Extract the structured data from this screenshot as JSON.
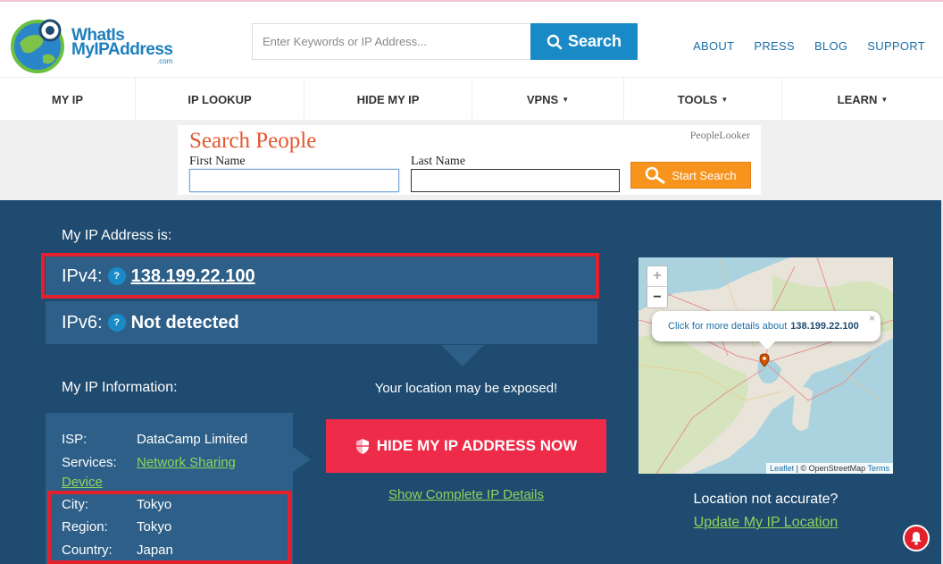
{
  "header": {
    "logo_line1": "WhatIs",
    "logo_line2": "MyIPAddress",
    "logo_suffix": ".com",
    "search_placeholder": "Enter Keywords or IP Address...",
    "search_button": "Search",
    "links": [
      "ABOUT",
      "PRESS",
      "BLOG",
      "SUPPORT"
    ]
  },
  "nav": {
    "items": [
      {
        "label": "MY IP",
        "dropdown": false
      },
      {
        "label": "IP LOOKUP",
        "dropdown": false
      },
      {
        "label": "HIDE MY IP",
        "dropdown": false
      },
      {
        "label": "VPNS",
        "dropdown": true
      },
      {
        "label": "TOOLS",
        "dropdown": true
      },
      {
        "label": "LEARN",
        "dropdown": true
      }
    ],
    "caret": "▼"
  },
  "ad": {
    "title": "Search People",
    "brand": "PeopleLooker",
    "first_name_label": "First Name",
    "last_name_label": "Last Name",
    "first_name_value": "",
    "last_name_value": "",
    "button": "Start Search"
  },
  "main": {
    "ip_heading": "My IP Address is:",
    "ipv4_label": "IPv4:",
    "ipv4_value": "138.199.22.100",
    "ipv6_label": "IPv6:",
    "ipv6_value": "Not detected",
    "help_glyph": "?",
    "info_heading": "My IP Information:",
    "info": {
      "isp_label": "ISP:",
      "isp_value": "DataCamp Limited",
      "services_label": "Services:",
      "services_value_line1": "Network Sharing",
      "services_value_line2": "Device",
      "city_label": "City:",
      "city_value": "Tokyo",
      "region_label": "Region:",
      "region_value": "Tokyo",
      "country_label": "Country:",
      "country_value": "Japan"
    },
    "exposed_text": "Your location may be exposed!",
    "hide_button": "HIDE MY IP ADDRESS NOW",
    "show_details": "Show Complete IP Details",
    "map": {
      "zoom_in": "+",
      "zoom_out": "−",
      "popup_text": "Click for more details about",
      "popup_ip": "138.199.22.100",
      "popup_close": "×",
      "attrib_leaflet": "Leaflet",
      "attrib_mid": " | © OpenStreetMap ",
      "attrib_terms": "Terms"
    },
    "location_question": "Location not accurate?",
    "update_location": "Update My IP Location"
  },
  "colors": {
    "brand_blue": "#1a8ac7",
    "panel_dark": "#1f4b70",
    "panel_light": "#2d5f88",
    "cta_red": "#ef2b4a",
    "link_green": "#8fd45a",
    "highlight_red": "#e3202b"
  }
}
